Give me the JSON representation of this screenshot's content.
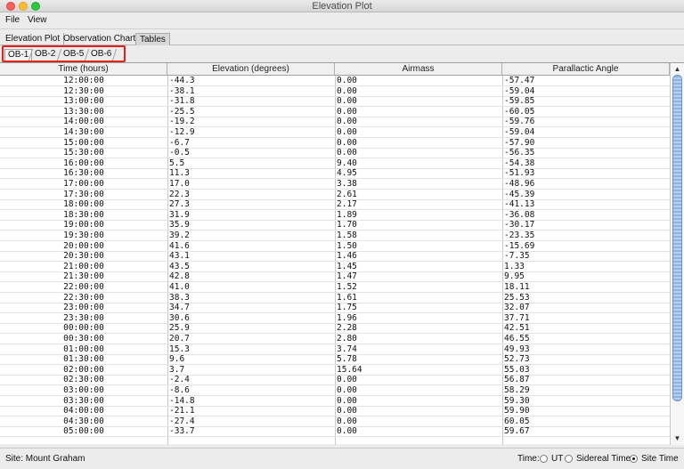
{
  "window": {
    "title": "Elevation Plot"
  },
  "menu": [
    "File",
    "View"
  ],
  "tabs": [
    {
      "label": "Elevation Plot",
      "selected": false
    },
    {
      "label": "Observation Chart",
      "selected": false
    },
    {
      "label": "Tables",
      "selected": true
    }
  ],
  "subtabs": [
    {
      "label": "OB-1",
      "selected": true
    },
    {
      "label": "OB-2",
      "selected": false
    },
    {
      "label": "OB-5",
      "selected": false
    },
    {
      "label": "OB-6",
      "selected": false
    }
  ],
  "table": {
    "columns": [
      "Time (hours)",
      "Elevation (degrees)",
      "Airmass",
      "Parallactic Angle"
    ],
    "rows": [
      [
        "12:00:00",
        "-44.3",
        "0.00",
        "-57.47"
      ],
      [
        "12:30:00",
        "-38.1",
        "0.00",
        "-59.04"
      ],
      [
        "13:00:00",
        "-31.8",
        "0.00",
        "-59.85"
      ],
      [
        "13:30:00",
        "-25.5",
        "0.00",
        "-60.05"
      ],
      [
        "14:00:00",
        "-19.2",
        "0.00",
        "-59.76"
      ],
      [
        "14:30:00",
        "-12.9",
        "0.00",
        "-59.04"
      ],
      [
        "15:00:00",
        "-6.7",
        "0.00",
        "-57.90"
      ],
      [
        "15:30:00",
        "-0.5",
        "0.00",
        "-56.35"
      ],
      [
        "16:00:00",
        "5.5",
        "9.40",
        "-54.38"
      ],
      [
        "16:30:00",
        "11.3",
        "4.95",
        "-51.93"
      ],
      [
        "17:00:00",
        "17.0",
        "3.38",
        "-48.96"
      ],
      [
        "17:30:00",
        "22.3",
        "2.61",
        "-45.39"
      ],
      [
        "18:00:00",
        "27.3",
        "2.17",
        "-41.13"
      ],
      [
        "18:30:00",
        "31.9",
        "1.89",
        "-36.08"
      ],
      [
        "19:00:00",
        "35.9",
        "1.70",
        "-30.17"
      ],
      [
        "19:30:00",
        "39.2",
        "1.58",
        "-23.35"
      ],
      [
        "20:00:00",
        "41.6",
        "1.50",
        "-15.69"
      ],
      [
        "20:30:00",
        "43.1",
        "1.46",
        "-7.35"
      ],
      [
        "21:00:00",
        "43.5",
        "1.45",
        "1.33"
      ],
      [
        "21:30:00",
        "42.8",
        "1.47",
        "9.95"
      ],
      [
        "22:00:00",
        "41.0",
        "1.52",
        "18.11"
      ],
      [
        "22:30:00",
        "38.3",
        "1.61",
        "25.53"
      ],
      [
        "23:00:00",
        "34.7",
        "1.75",
        "32.07"
      ],
      [
        "23:30:00",
        "30.6",
        "1.96",
        "37.71"
      ],
      [
        "00:00:00",
        "25.9",
        "2.28",
        "42.51"
      ],
      [
        "00:30:00",
        "20.7",
        "2.80",
        "46.55"
      ],
      [
        "01:00:00",
        "15.3",
        "3.74",
        "49.93"
      ],
      [
        "01:30:00",
        "9.6",
        "5.78",
        "52.73"
      ],
      [
        "02:00:00",
        "3.7",
        "15.64",
        "55.03"
      ],
      [
        "02:30:00",
        "-2.4",
        "0.00",
        "56.87"
      ],
      [
        "03:00:00",
        "-8.6",
        "0.00",
        "58.29"
      ],
      [
        "03:30:00",
        "-14.8",
        "0.00",
        "59.30"
      ],
      [
        "04:00:00",
        "-21.1",
        "0.00",
        "59.90"
      ],
      [
        "04:30:00",
        "-27.4",
        "0.00",
        "60.05"
      ],
      [
        "05:00:00",
        "-33.7",
        "0.00",
        "59.67"
      ]
    ]
  },
  "status": {
    "site": "Site: Mount Graham",
    "time_label": "Time:",
    "options": [
      {
        "label": "UT",
        "selected": false
      },
      {
        "label": "Sidereal Time",
        "selected": false
      },
      {
        "label": "Site Time",
        "selected": true
      }
    ]
  },
  "colors": {
    "highlight_box": "#e0221a",
    "scroll_thumb": "#8fb3df"
  }
}
